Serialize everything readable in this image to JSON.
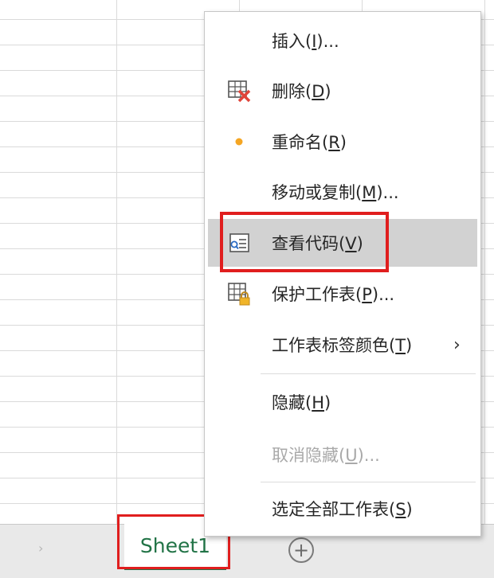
{
  "context_menu": {
    "items": [
      {
        "label": "插入(",
        "key": "I",
        "suffix": ")...",
        "icon": "none",
        "disabled": false
      },
      {
        "label": "删除(",
        "key": "D",
        "suffix": ")",
        "icon": "delete-sheet-icon",
        "disabled": false
      },
      {
        "label": "重命名(",
        "key": "R",
        "suffix": ")",
        "icon": "dot-icon",
        "disabled": false
      },
      {
        "label": "移动或复制(",
        "key": "M",
        "suffix": ")...",
        "icon": "none",
        "disabled": false
      },
      {
        "label": "查看代码(",
        "key": "V",
        "suffix": ")",
        "icon": "view-code-icon",
        "disabled": false
      },
      {
        "label": "保护工作表(",
        "key": "P",
        "suffix": ")...",
        "icon": "protect-sheet-icon",
        "disabled": false
      },
      {
        "label": "工作表标签颜色(",
        "key": "T",
        "suffix": ")",
        "icon": "none",
        "disabled": false,
        "submenu": "›"
      },
      {
        "label": "隐藏(",
        "key": "H",
        "suffix": ")",
        "icon": "none",
        "disabled": false
      },
      {
        "label": "取消隐藏(",
        "key": "U",
        "suffix": ")...",
        "icon": "none",
        "disabled": true
      },
      {
        "label": "选定全部工作表(",
        "key": "S",
        "suffix": ")",
        "icon": "none",
        "disabled": false
      }
    ],
    "hovered_item": "查看代码"
  },
  "sheet_tabs": {
    "tabs": [
      {
        "label": "Sheet1",
        "active": true
      }
    ],
    "add_symbol": "+",
    "nav_symbol": "›"
  },
  "colors": {
    "accent_green": "#217346",
    "highlight_red": "#e01e1e",
    "hover_gray": "#d2d2d2"
  }
}
